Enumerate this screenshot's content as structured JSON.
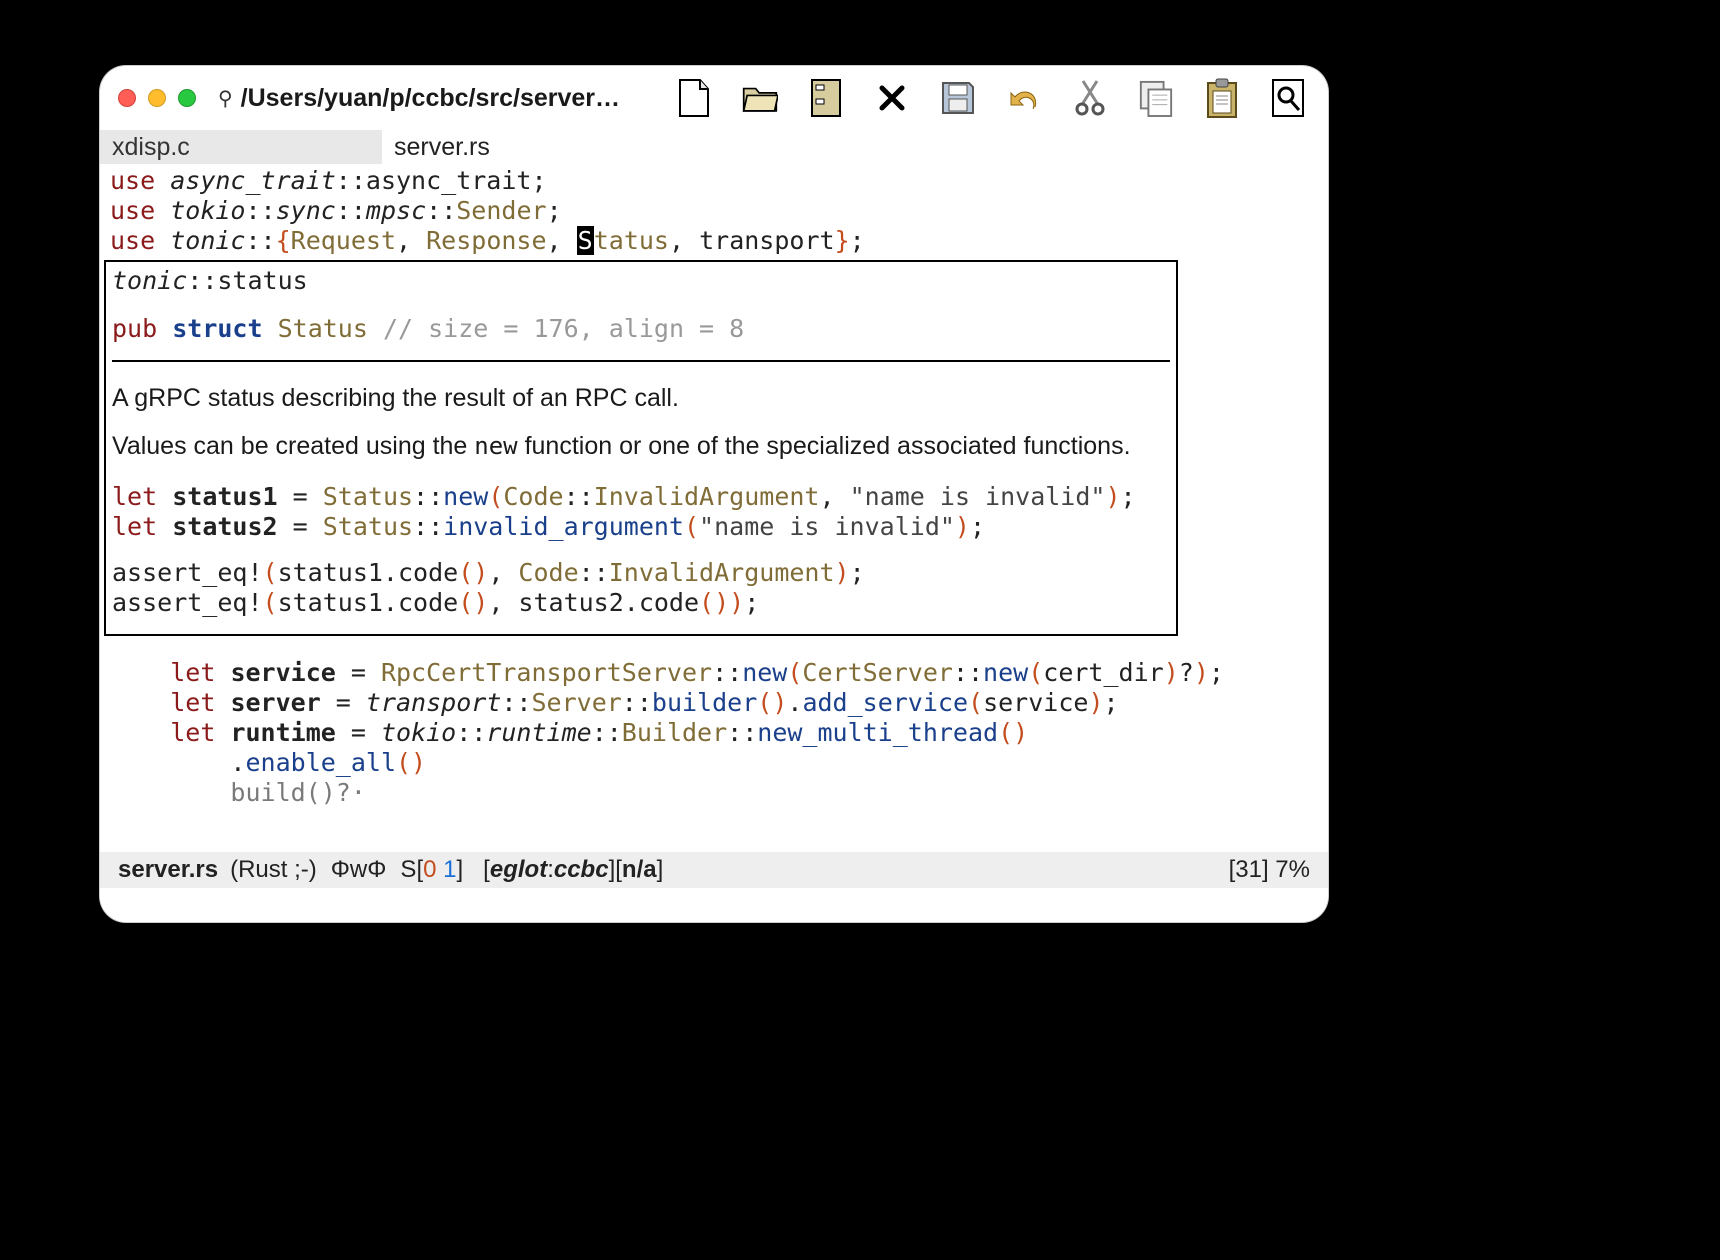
{
  "title": "/Users/yuan/p/ccbc/src/server…",
  "tabs": {
    "inactive": "xdisp.c",
    "active": "server.rs"
  },
  "code": {
    "l1": {
      "use": "use",
      "path": "async_trait",
      "tail": "::async_trait;"
    },
    "l2": {
      "use": "use",
      "path": "tokio",
      "seg1": "::",
      "sync": "sync",
      "seg2": "::",
      "mpsc": "mpsc",
      "seg3": "::",
      "sender": "Sender",
      "semi": ";"
    },
    "l3": {
      "use": "use",
      "path": "tonic",
      "seg": "::",
      "lbr": "{",
      "req": "Request",
      "c1": ", ",
      "resp": "Response",
      "c2": ", ",
      "status_cursor": "S",
      "status_rest": "tatus",
      "c3": ", ",
      "transport": "transport",
      "rbr": "}",
      "semi": ";"
    }
  },
  "popup": {
    "head_path": "tonic",
    "head_tail": "::status",
    "pub": "pub",
    "struct": "struct",
    "name": "Status",
    "comment": "// size = 176, align = 8",
    "doc1": "A gRPC status describing the result of an RPC call.",
    "doc2a": "Values can be created using the ",
    "doc2_mono": "new",
    "doc2b": " function or one of the specialized associated functions.",
    "s1": {
      "let": "let",
      "var": "status1",
      "eq": " = ",
      "ty": "Status",
      "colons": "::",
      "fn": "new",
      "lpar": "(",
      "arg1a": "Code",
      "arg1b": "::",
      "arg1c": "InvalidArgument",
      "comma": ", ",
      "str": "\"name is invalid\"",
      "rpar": ")",
      "semi": ";"
    },
    "s2": {
      "let": "let",
      "var": "status2",
      "eq": " = ",
      "ty": "Status",
      "colons": "::",
      "fn": "invalid_argument",
      "lpar": "(",
      "str": "\"name is invalid\"",
      "rpar": ")",
      "semi": ";"
    },
    "a1": {
      "head": "assert_eq!",
      "l": "(",
      "a": "status1.code",
      "ap": "()",
      "c": ", ",
      "b1": "Code",
      "b2": "::",
      "b3": "InvalidArgument",
      "r": ")",
      "semi": ";"
    },
    "a2": {
      "head": "assert_eq!",
      "l": "(",
      "a": "status1.code",
      "ap": "()",
      "c": ", ",
      "b": "status2.code",
      "bp": "()",
      "r": ")",
      "semi": ";"
    }
  },
  "below": {
    "b1": {
      "let": "let",
      "var": "service",
      "eq": " = ",
      "ty": "RpcCertTransportServer",
      "c": "::",
      "fn": "new",
      "l": "(",
      "ty2": "CertServer",
      "c2": "::",
      "fn2": "new",
      "l2": "(",
      "arg": "cert_dir",
      "r2": ")",
      "q": "?",
      "r": ")",
      "semi": ";"
    },
    "b2": {
      "let": "let",
      "var": "server",
      "eq": " = ",
      "p": "transport",
      "c": "::",
      "ty": "Server",
      "c2": "::",
      "fn": "builder",
      "lp": "()",
      "dot": ".",
      "fn2": "add_service",
      "l": "(",
      "arg": "service",
      "r": ")",
      "semi": ";"
    },
    "b3": {
      "let": "let",
      "var": "runtime",
      "eq": " = ",
      "p": "tokio",
      "c": "::",
      "p2": "runtime",
      "c2": "::",
      "ty": "Builder",
      "c3": "::",
      "fn": "new_multi_thread",
      "lp": "()"
    },
    "b4": {
      "dot": ".",
      "fn": "enable_all",
      "lp": "()"
    },
    "b5": {
      "text": "build()?·"
    }
  },
  "modeline": {
    "file": "server.rs",
    "mode": "(Rust ;-)",
    "fly": "ΦwΦ",
    "s_label": "S",
    "s_lbr": "[",
    "s_zero": "0",
    "s_sp": " ",
    "s_one": "1",
    "s_rbr": "]",
    "eglot_l": " [",
    "eglot": "eglot",
    "eglot_colon": ":",
    "eglot_proj": "ccbc",
    "eglot_r": "] ",
    "na_l": "[",
    "na": "n/a",
    "na_r": "]",
    "pos": "[31] 7%"
  }
}
